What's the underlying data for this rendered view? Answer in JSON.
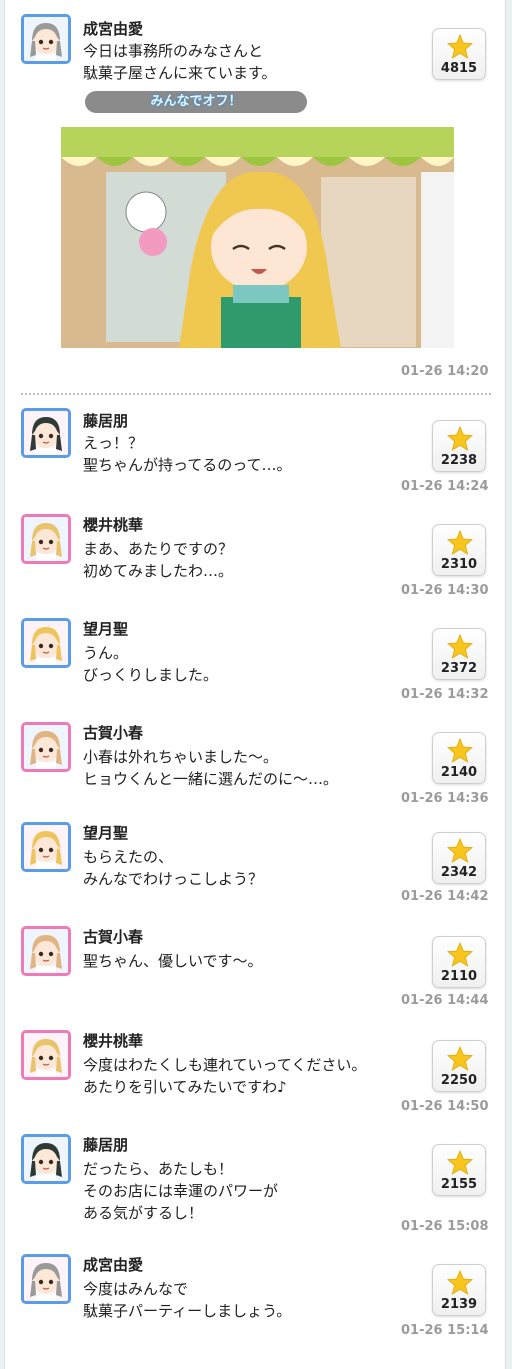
{
  "posts": [
    {
      "name": "成宮由愛",
      "lines": [
        "今日は事務所のみなさんと",
        "駄菓子屋さんに来ています。"
      ],
      "likes": "4815",
      "time": "01-26 14:20",
      "hair": "#9a9a9a",
      "frame": "blue",
      "tag": "みんなでオフ！"
    },
    {
      "name": "藤居朋",
      "lines": [
        "えっ！？",
        "聖ちゃんが持ってるのって…。"
      ],
      "likes": "2238",
      "time": "01-26 14:24",
      "hair": "#2f3a36",
      "frame": "blue"
    },
    {
      "name": "櫻井桃華",
      "lines": [
        "まあ、あたりですの？",
        "初めてみましたわ…。"
      ],
      "likes": "2310",
      "time": "01-26 14:30",
      "hair": "#e9c46a",
      "frame": "pink"
    },
    {
      "name": "望月聖",
      "lines": [
        "うん。",
        "びっくりしました。"
      ],
      "likes": "2372",
      "time": "01-26 14:32",
      "hair": "#efc45a",
      "frame": "blue"
    },
    {
      "name": "古賀小春",
      "lines": [
        "小春は外れちゃいました〜。",
        "ヒョウくんと一緒に選んだのに〜…。"
      ],
      "likes": "2140",
      "time": "01-26 14:36",
      "hair": "#e2b482",
      "frame": "pink"
    },
    {
      "name": "望月聖",
      "lines": [
        "もらえたの、",
        "みんなでわけっこしよう？"
      ],
      "likes": "2342",
      "time": "01-26 14:42",
      "hair": "#efc45a",
      "frame": "blue"
    },
    {
      "name": "古賀小春",
      "lines": [
        "聖ちゃん、優しいです〜。"
      ],
      "likes": "2110",
      "time": "01-26 14:44",
      "hair": "#e2b482",
      "frame": "pink"
    },
    {
      "name": "櫻井桃華",
      "lines": [
        "今度はわたくしも連れていってください。",
        "あたりを引いてみたいですわ♪"
      ],
      "likes": "2250",
      "time": "01-26 14:50",
      "hair": "#e9c46a",
      "frame": "pink"
    },
    {
      "name": "藤居朋",
      "lines": [
        "だったら、あたしも！",
        "そのお店には幸運のパワーが",
        "ある気がするし！"
      ],
      "likes": "2155",
      "time": "01-26 15:08",
      "hair": "#2f3a36",
      "frame": "blue"
    },
    {
      "name": "成宮由愛",
      "lines": [
        "今度はみんなで",
        "駄菓子パーティーしましょう。"
      ],
      "likes": "2139",
      "time": "01-26 15:14",
      "hair": "#9a9a9a",
      "frame": "blue"
    }
  ],
  "icons": {
    "like": "star-icon",
    "avatar": "character-avatar"
  },
  "colors": {
    "star": "#f7c51e",
    "time": "#9b9b9b",
    "tag_bg": "#8b8b8b"
  }
}
